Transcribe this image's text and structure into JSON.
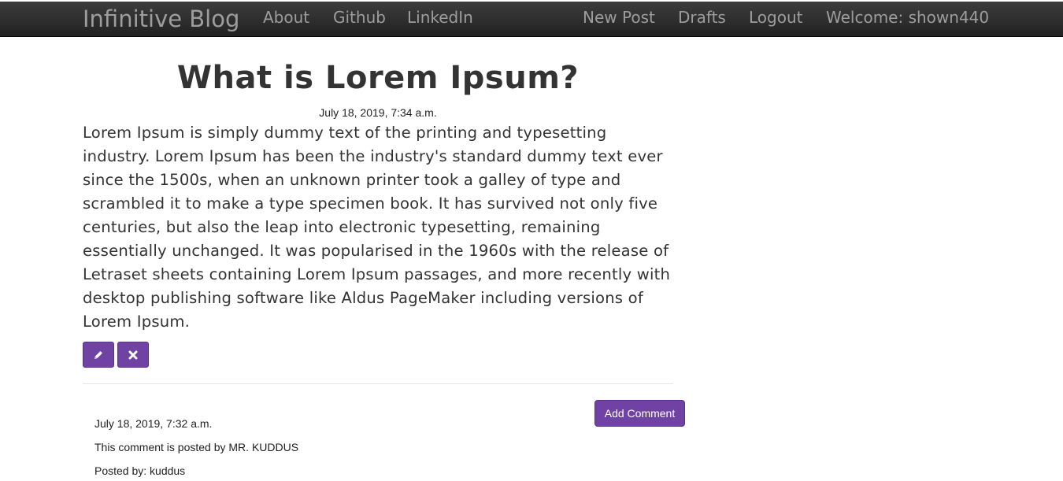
{
  "navbar": {
    "brand": "Infinitive Blog",
    "left_links": [
      "About",
      "Github",
      "LinkedIn"
    ],
    "right_links": [
      "New Post",
      "Drafts",
      "Logout"
    ],
    "welcome": "Welcome: shown440",
    "text_color": "#9d9d9d"
  },
  "post": {
    "title": "What is Lorem Ipsum?",
    "date": "July 18, 2019, 7:34 a.m.",
    "body": "Lorem Ipsum is simply dummy text of the printing and typesetting industry. Lorem Ipsum has been the industry's standard dummy text ever since the 1500s, when an unknown printer took a galley of type and scrambled it to make a type specimen book. It has survived not only five centuries, but also the leap into electronic typesetting, remaining essentially unchanged. It was popularised in the 1960s with the release of Letraset sheets containing Lorem Ipsum passages, and more recently with desktop publishing software like Aldus PageMaker including versions of Lorem Ipsum.",
    "edit_icon": "pencil-icon",
    "delete_icon": "close-icon",
    "accent_color": "#6f42a3"
  },
  "comments": {
    "add_label": "Add Comment",
    "items": [
      {
        "date": "July 18, 2019, 7:32 a.m.",
        "text": "This comment is posted by MR. KUDDUS",
        "posted_by": "Posted by: kuddus"
      }
    ]
  }
}
